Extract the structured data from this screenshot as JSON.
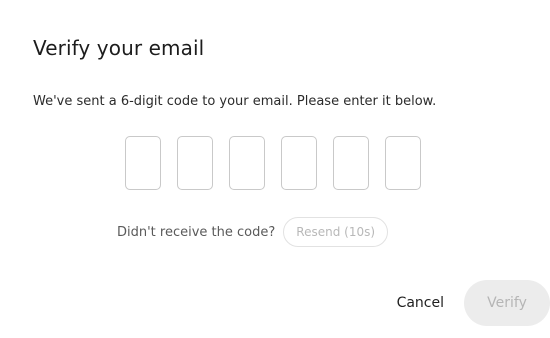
{
  "dialog": {
    "title": "Verify your email",
    "description": "We've sent a 6-digit code to your email. Please enter it below.",
    "code_digits": [
      "",
      "",
      "",
      "",
      "",
      ""
    ],
    "resend": {
      "prompt": "Didn't receive the code?",
      "button_label": "Resend (10s)",
      "enabled": false
    },
    "actions": {
      "cancel_label": "Cancel",
      "verify_label": "Verify",
      "verify_enabled": false
    }
  },
  "colors": {
    "text_primary": "#1c1c1c",
    "box_border": "#c9c9c9",
    "disabled_text": "#b5b5b5",
    "disabled_bg": "#ececec"
  }
}
